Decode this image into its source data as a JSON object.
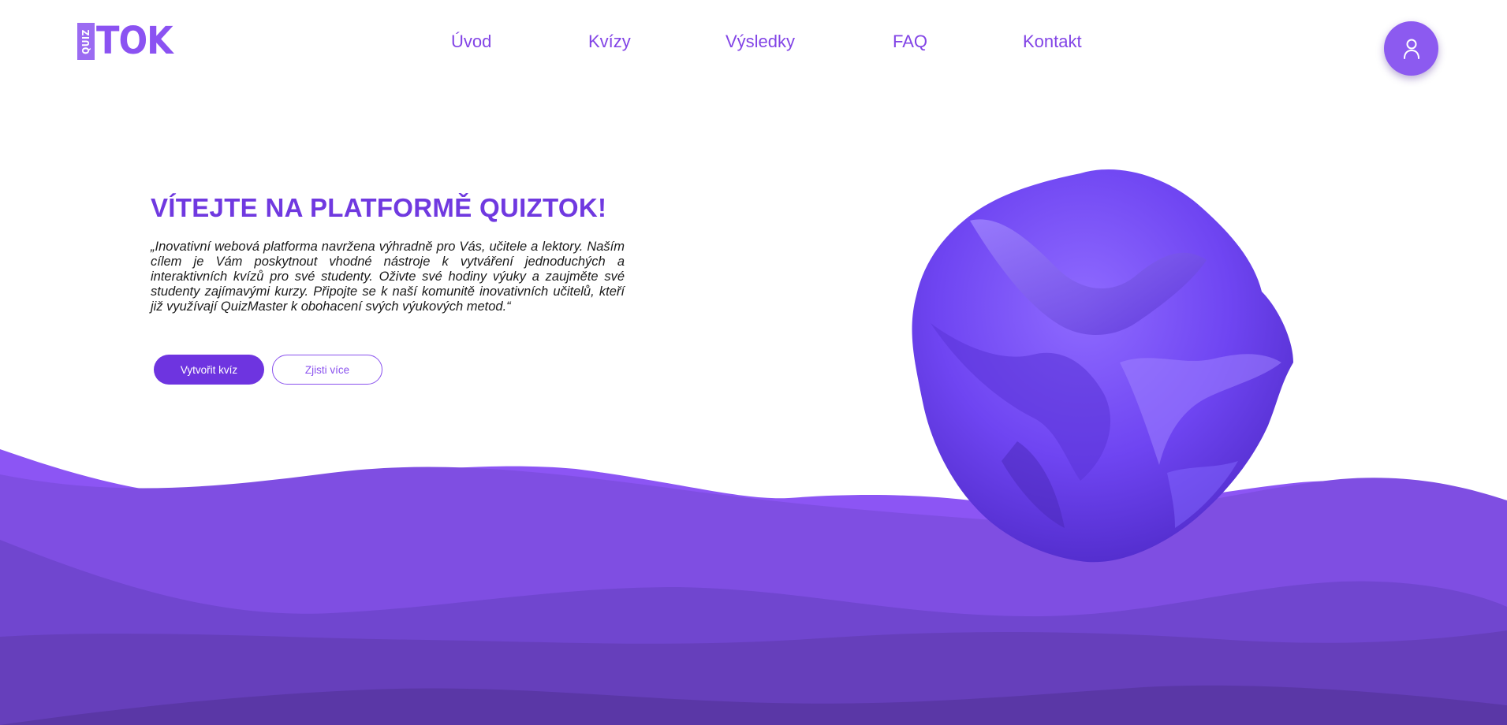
{
  "logo": {
    "small_text": "QUIZ",
    "big_text": "TOK"
  },
  "nav": {
    "items": [
      "Úvod",
      "Kvízy",
      "Výsledky",
      "FAQ",
      "Kontakt"
    ]
  },
  "user_button": {
    "icon": "user-icon"
  },
  "hero": {
    "title": "VÍTEJTE NA PLATFORMĚ QUIZTOK!",
    "text": "„Inovativní webová platforma navržena výhradně pro Vás, učitele a lektory. Naším cílem je Vám poskytnout vhodné nástroje k vytváření jednoduchých a interaktivních kvízů pro své studenty. Oživte své hodiny výuky a zaujměte své studenty zajímavými kurzy. Připojte se k naší komunitě inovativních učitelů, kteří již využívají QuizMaster k obohacení svých výukových metod.“",
    "primary_button": "Vytvořit kvíz",
    "secondary_button": "Zjisti více"
  },
  "colors": {
    "brand": "#7039e0",
    "accent_light": "#8b52f2",
    "wave_1": "#8c55f4",
    "wave_2": "#7f4ee2",
    "wave_3": "#7046cf",
    "wave_4": "#663fbb",
    "wave_5": "#5a37a6"
  },
  "illustration": {
    "icon": "abstract-3d-shape-icon"
  }
}
